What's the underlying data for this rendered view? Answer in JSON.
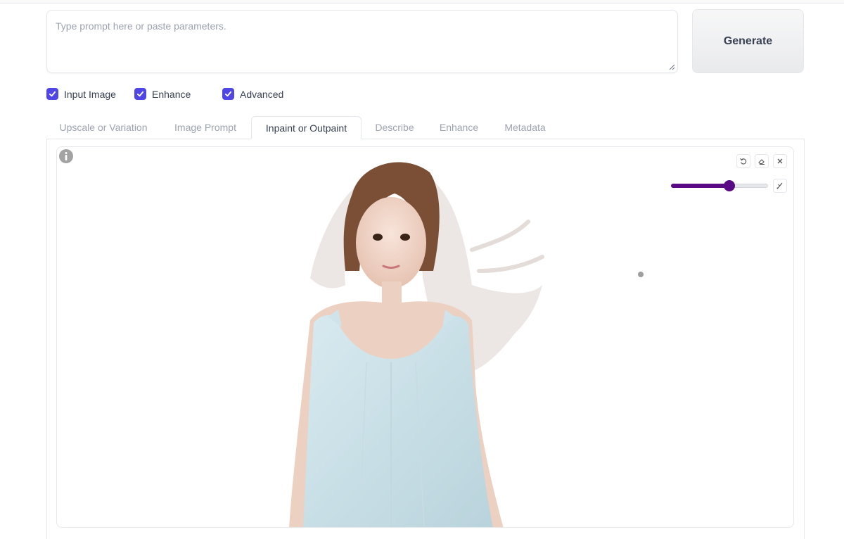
{
  "prompt": {
    "placeholder": "Type prompt here or paste parameters.",
    "value": ""
  },
  "generate": {
    "label": "Generate"
  },
  "options": [
    {
      "label": "Input Image",
      "checked": true
    },
    {
      "label": "Enhance",
      "checked": true
    },
    {
      "label": "Advanced",
      "checked": true
    }
  ],
  "tabs": [
    {
      "label": "Upscale or Variation",
      "active": false
    },
    {
      "label": "Image Prompt",
      "active": false
    },
    {
      "label": "Inpaint or Outpaint",
      "active": true
    },
    {
      "label": "Describe",
      "active": false
    },
    {
      "label": "Enhance",
      "active": false
    },
    {
      "label": "Metadata",
      "active": false
    }
  ],
  "canvas": {
    "tools": [
      "undo-icon",
      "eraser-icon",
      "close-icon",
      "brush-color-icon"
    ],
    "brush_size_fraction": 0.6,
    "accent_color": "#5b0a86"
  }
}
